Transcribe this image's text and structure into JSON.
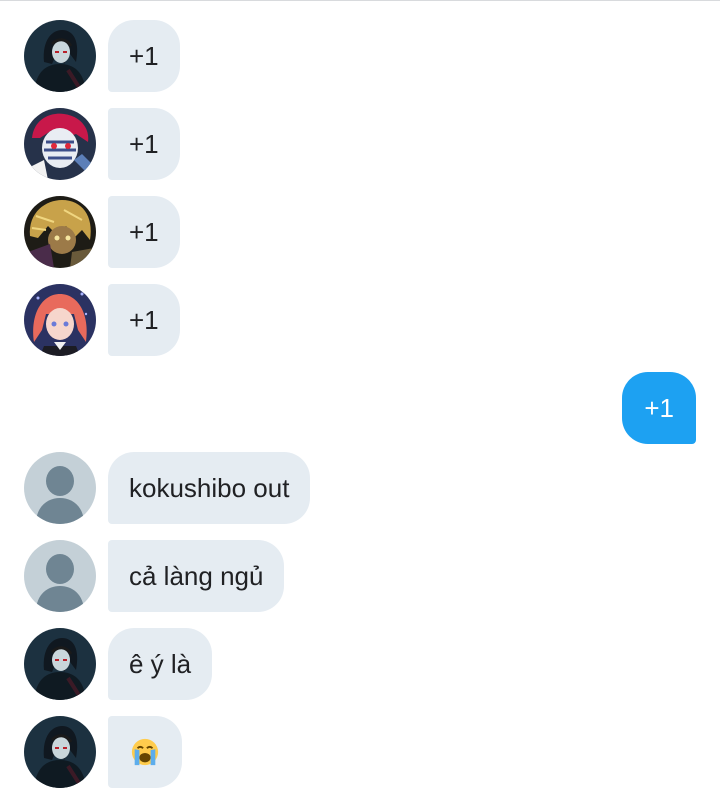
{
  "messages": [
    {
      "sender": "avatar-dark-hair",
      "text": "+1"
    },
    {
      "sender": "avatar-red-white-mask",
      "text": "+1"
    },
    {
      "sender": "avatar-golden-hair",
      "text": "+1"
    },
    {
      "sender": "avatar-pink-hair",
      "text": "+1"
    },
    {
      "sender": "me",
      "text": "+1"
    },
    {
      "sender": "default-avatar",
      "text": "kokushibo out"
    },
    {
      "sender": "default-avatar",
      "text": "cả làng ngủ"
    },
    {
      "sender": "avatar-dark-hair",
      "text": "ê ý là"
    },
    {
      "sender": "avatar-dark-hair",
      "emoji": "loudly-crying-face"
    }
  ],
  "colors": {
    "incoming_bubble": "#e5ecf2",
    "outgoing_bubble": "#1da1f2",
    "text_dark": "#202124",
    "text_light": "#ffffff"
  }
}
